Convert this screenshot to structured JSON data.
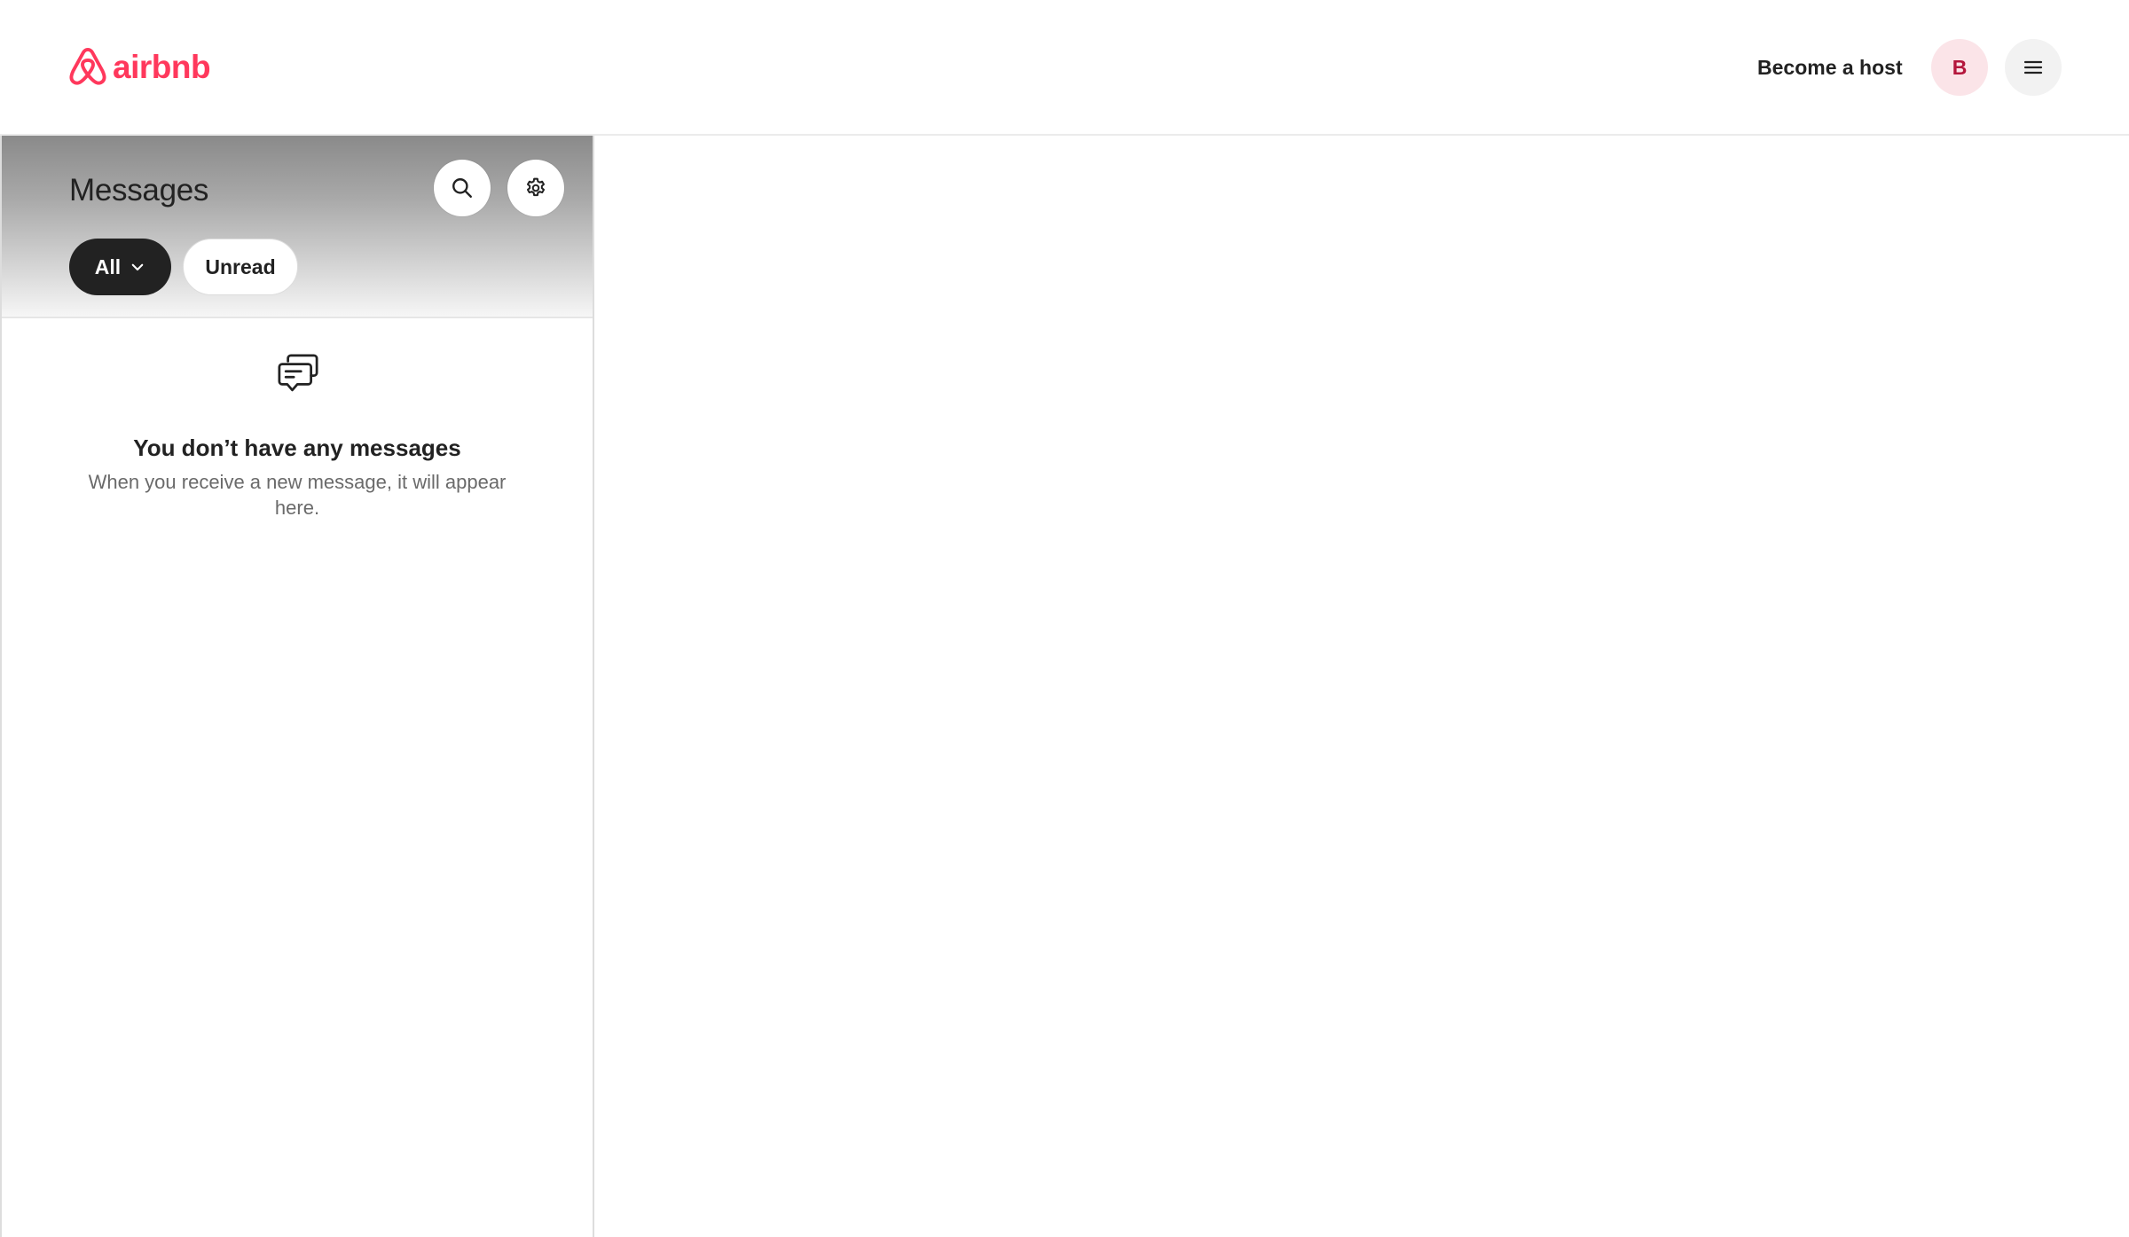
{
  "brand": {
    "name": "airbnb",
    "logo_icon": "airbnb-belo-icon",
    "color": "#ff385c"
  },
  "header": {
    "become_host_label": "Become a host",
    "avatar_initial": "B",
    "menu_icon": "hamburger-menu-icon"
  },
  "sidebar": {
    "title": "Messages",
    "search_icon": "search-icon",
    "settings_icon": "gear-icon",
    "filters": {
      "all_label": "All",
      "unread_label": "Unread",
      "selected": "All"
    }
  },
  "empty_state": {
    "icon": "chat-bubbles-icon",
    "title": "You don’t have any messages",
    "description": "When you receive a new message, it will appear here."
  },
  "colors": {
    "brand": "#ff385c",
    "avatar_bg": "#fbe4e8",
    "avatar_text": "#b4163c",
    "active_filter_bg": "#222222",
    "text_primary": "#222222",
    "text_secondary": "#6a6a6a"
  }
}
